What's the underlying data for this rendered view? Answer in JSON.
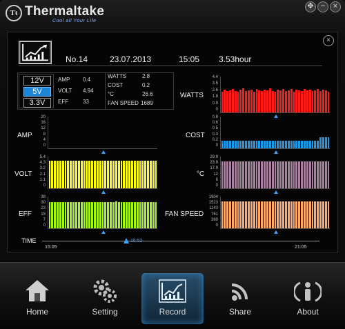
{
  "app": {
    "brand": "Thermaltake",
    "tagline": "Cool all Your Life"
  },
  "header": {
    "number": "No.14",
    "date": "23.07.2013",
    "time": "15:05",
    "duration": "3.53hour"
  },
  "rails": [
    "12V",
    "5V",
    "3.3V"
  ],
  "selected_rail": "5V",
  "readings_left": [
    {
      "label": "AMP",
      "value": "0.4"
    },
    {
      "label": "VOLT",
      "value": "4.94"
    },
    {
      "label": "EFF",
      "value": "33"
    }
  ],
  "readings_right": [
    {
      "label": "WATTS",
      "value": "2.8"
    },
    {
      "label": "COST",
      "value": "0.2"
    },
    {
      "label": "°C",
      "value": "26.6"
    },
    {
      "label": "FAN SPEED",
      "value": "1689"
    }
  ],
  "chart_data": [
    {
      "type": "bar",
      "title": "AMP",
      "color": "#000000",
      "yticks": [
        "20",
        "16",
        "12",
        "8",
        "4",
        "0"
      ],
      "values": []
    },
    {
      "type": "bar",
      "title": "VOLT",
      "color": "#ffff1a",
      "yticks": [
        "5.4",
        "4.3",
        "3.2",
        "2.1",
        "1.1",
        "0"
      ],
      "values": [
        4.94,
        4.94,
        4.94,
        4.94,
        4.94,
        4.94,
        4.94,
        4.94,
        4.94,
        4.94,
        4.94,
        4.94,
        4.94,
        4.94,
        4.94,
        4.94,
        4.94,
        4.94,
        4.94,
        4.94,
        4.94,
        4.94,
        4.94,
        4.94,
        4.94,
        4.94,
        4.94,
        4.94,
        4.94,
        4.94,
        4.94,
        4.94,
        4.94,
        4.94,
        4.94,
        4.94,
        4.94,
        4.94,
        4.94,
        4.94,
        4.94
      ]
    },
    {
      "type": "bar",
      "title": "EFF",
      "color": "#a8f51a",
      "yticks": [
        "38",
        "30",
        "23",
        "15",
        "7",
        "0"
      ],
      "values": [
        33,
        33,
        33,
        33,
        33,
        33,
        33,
        33,
        33,
        33,
        33,
        33,
        33,
        33,
        33,
        33,
        33,
        33,
        33,
        33,
        33,
        33,
        33,
        33,
        33,
        34,
        33,
        33,
        33,
        33,
        33,
        33,
        33,
        33,
        33,
        33,
        33,
        33,
        33,
        33,
        33
      ]
    },
    {
      "type": "bar",
      "title": "WATTS",
      "color": "#ff1a1a",
      "yticks": [
        "4.4",
        "3.5",
        "2.6",
        "1.8",
        "0.9",
        "0"
      ],
      "values": [
        2.6,
        2.9,
        2.7,
        2.8,
        3.0,
        2.7,
        2.6,
        2.9,
        3.1,
        2.7,
        2.8,
        2.9,
        2.6,
        3.0,
        2.8,
        2.7,
        2.9,
        2.8,
        3.1,
        2.7,
        2.6,
        2.9,
        2.8,
        3.0,
        2.7,
        2.8,
        3.0,
        2.6,
        2.9,
        2.8,
        2.7,
        3.0,
        2.8,
        2.9,
        2.7,
        2.8,
        3.0,
        2.7,
        2.9,
        2.8,
        2.6
      ]
    },
    {
      "type": "bar",
      "title": "COST",
      "color": "#1a9ae6",
      "yticks": [
        "0.8",
        "0.6",
        "0.5",
        "0.3",
        "0.2",
        "0"
      ],
      "values": [
        0.2,
        0.2,
        0.2,
        0.2,
        0.2,
        0.2,
        0.2,
        0.2,
        0.2,
        0.2,
        0.2,
        0.2,
        0.2,
        0.2,
        0.2,
        0.2,
        0.2,
        0.2,
        0.2,
        0.2,
        0.2,
        0.2,
        0.2,
        0.2,
        0.2,
        0.2,
        0.2,
        0.2,
        0.2,
        0.2,
        0.2,
        0.2,
        0.2,
        0.2,
        0.2,
        0.2,
        0.2,
        0.3,
        0.3,
        0.3,
        0.3
      ]
    },
    {
      "type": "bar",
      "title": "°C",
      "color": "#a9829f",
      "yticks": [
        "29.9",
        "23.9",
        "17.9",
        "12",
        "6",
        "0"
      ],
      "values": [
        26.6,
        26.6,
        26.6,
        26.6,
        26.6,
        26.6,
        26.6,
        26.6,
        26.6,
        26.6,
        26.6,
        26.6,
        26.6,
        26.6,
        26.6,
        26.6,
        26.6,
        26.6,
        26.6,
        26.6,
        26.6,
        26.6,
        26.6,
        26.6,
        26.6,
        26.6,
        26.2,
        26.2,
        26.2,
        26.2,
        26.6,
        26.6,
        26.6,
        26.6,
        26.6,
        26.6,
        26.6,
        26.6,
        26.6,
        26.6,
        26.6
      ]
    },
    {
      "type": "bar",
      "title": "FAN SPEED",
      "color": "#ffaa66",
      "yticks": [
        "1904",
        "1523",
        "1143",
        "761",
        "380",
        "0"
      ],
      "values": [
        1689,
        1689,
        1689,
        1689,
        1689,
        1689,
        1689,
        1689,
        1689,
        1689,
        1689,
        1689,
        1689,
        1689,
        1689,
        1689,
        1689,
        1689,
        1689,
        1689,
        1689,
        1689,
        1689,
        1689,
        1689,
        1689,
        1689,
        1689,
        1689,
        1689,
        1689,
        1689,
        1689,
        1689,
        1689,
        1689,
        1689,
        1689,
        1689,
        1689,
        1689
      ]
    }
  ],
  "timeline": {
    "label": "TIME",
    "start": "15:05",
    "end": "21:05",
    "cursor": "16:52",
    "cursor_position": 0.25
  },
  "nav": [
    {
      "label": "Home",
      "icon": "home-icon"
    },
    {
      "label": "Setting",
      "icon": "gear-icon"
    },
    {
      "label": "Record",
      "icon": "chart-icon"
    },
    {
      "label": "Share",
      "icon": "share-icon"
    },
    {
      "label": "About",
      "icon": "info-person-icon"
    }
  ],
  "active_nav": "Record"
}
